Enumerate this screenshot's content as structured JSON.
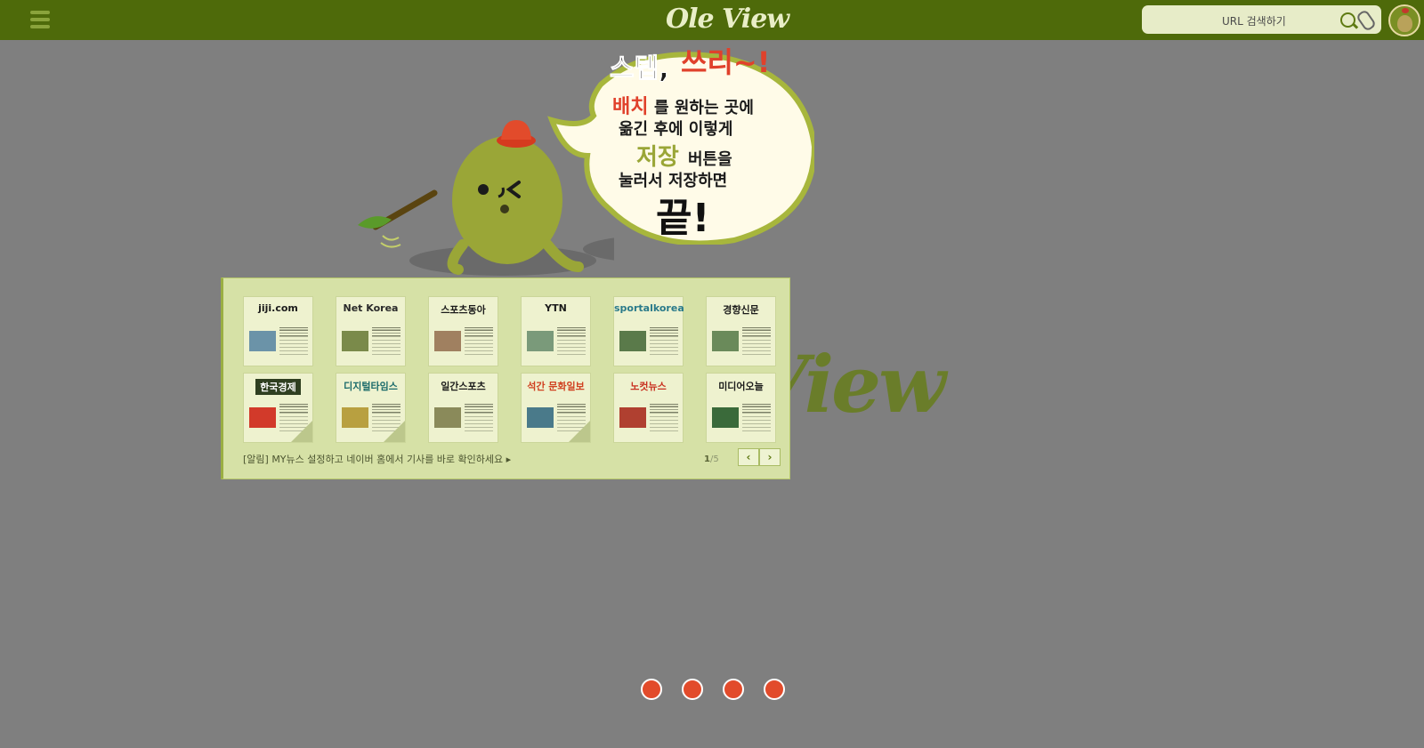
{
  "header": {
    "logo_text": "Ole View",
    "search_placeholder": "URL 검색하기",
    "menu_icon": "hamburger-menu-icon",
    "search_icon": "search-icon",
    "attach_icon": "paperclip-icon",
    "avatar_icon": "olive-avatar-icon"
  },
  "background_watermark": "View",
  "bubble": {
    "line1a": "스텝, ",
    "line1b": "쓰리~!",
    "line2a": "배치",
    "line2b": "를 원하는 곳에",
    "line3": "옮긴 후에 이렇게",
    "line4a": "저장",
    "line4b": "버튼을",
    "line5": "눌러서 저장하면",
    "line6": "끝!"
  },
  "publishers": [
    {
      "name": "jiji.com"
    },
    {
      "name": "Net Korea"
    },
    {
      "name": "스포츠동아"
    },
    {
      "name": "YTN"
    },
    {
      "name": "sportalkorea"
    },
    {
      "name": "경향신문"
    },
    {
      "name": "한국경제"
    },
    {
      "name": "디지털타임스"
    },
    {
      "name": "일간스포츠"
    },
    {
      "name": "석간 문화일보"
    },
    {
      "name": "노컷뉴스"
    },
    {
      "name": "미디어오늘"
    }
  ],
  "notice": "[알림] MY뉴스 설정하고 네이버 홈에서 기사를 바로 확인하세요 ▸",
  "pager": {
    "current": "1",
    "total": "/5"
  },
  "nav": {
    "prev": "‹",
    "next": "›"
  },
  "colors": {
    "topbar": "#4e6a0a",
    "panel": "#d6e1a6",
    "dot": "#e24b2b",
    "accent_red": "#e0412b"
  }
}
